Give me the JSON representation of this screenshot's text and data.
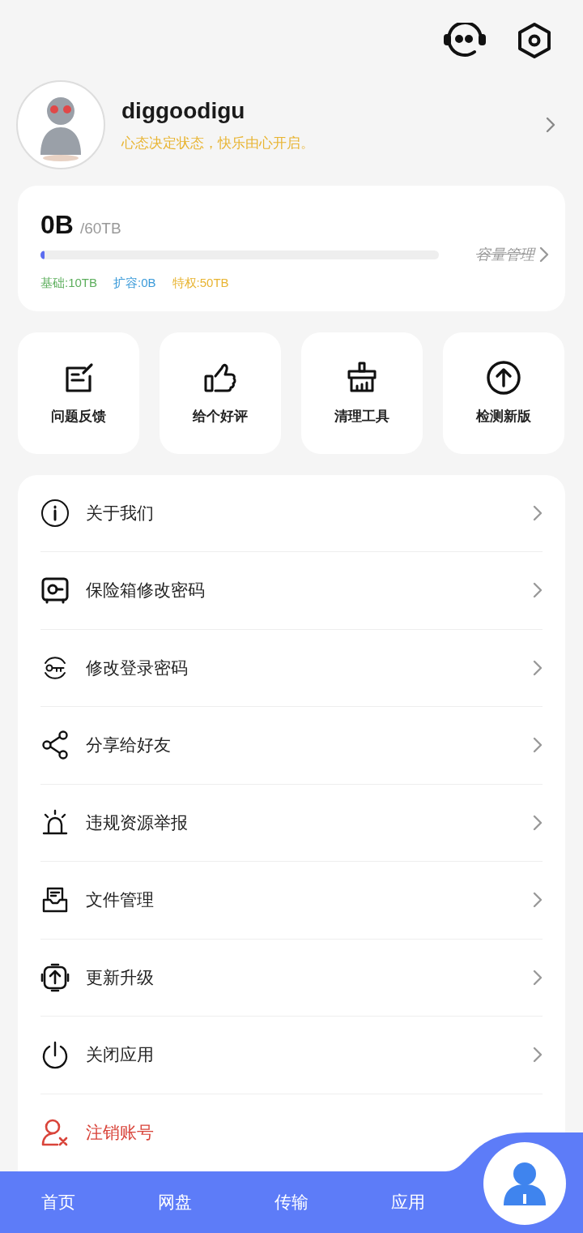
{
  "profile": {
    "username": "diggoodigu",
    "motto": "心态决定状态，快乐由心开启。"
  },
  "storage": {
    "used": "0B",
    "total": "/60TB",
    "level": 0.01,
    "manage": {
      "label": "容量管理",
      "disabled": true
    },
    "breakdown": [
      {
        "label": "基础:10TB",
        "color": "#5cae5c"
      },
      {
        "label": "扩容:0B",
        "color": "#3a9ad9"
      },
      {
        "label": "特权:50TB",
        "color": "#e8b431"
      }
    ]
  },
  "tools": [
    {
      "label": "问题反馈"
    },
    {
      "label": "给个好评"
    },
    {
      "label": "清理工具"
    },
    {
      "label": "检测新版"
    }
  ],
  "menu": [
    {
      "label": "关于我们",
      "kind": "normal"
    },
    {
      "label": "保险箱修改密码",
      "kind": "normal"
    },
    {
      "label": "修改登录密码",
      "kind": "normal"
    },
    {
      "label": "分享给好友",
      "kind": "normal"
    },
    {
      "label": "违规资源举报",
      "kind": "normal"
    },
    {
      "label": "文件管理",
      "kind": "normal"
    },
    {
      "label": "更新升级",
      "kind": "normal"
    },
    {
      "label": "关闭应用",
      "kind": "normal"
    },
    {
      "label": "注销账号",
      "kind": "danger"
    }
  ],
  "nav": [
    {
      "label": "首页",
      "kind": "text",
      "selected": false
    },
    {
      "label": "网盘",
      "kind": "text",
      "selected": false
    },
    {
      "label": "传输",
      "kind": "text",
      "selected": false
    },
    {
      "label": "应用",
      "kind": "text",
      "selected": false
    },
    {
      "kind": "profile",
      "selected": true
    }
  ]
}
